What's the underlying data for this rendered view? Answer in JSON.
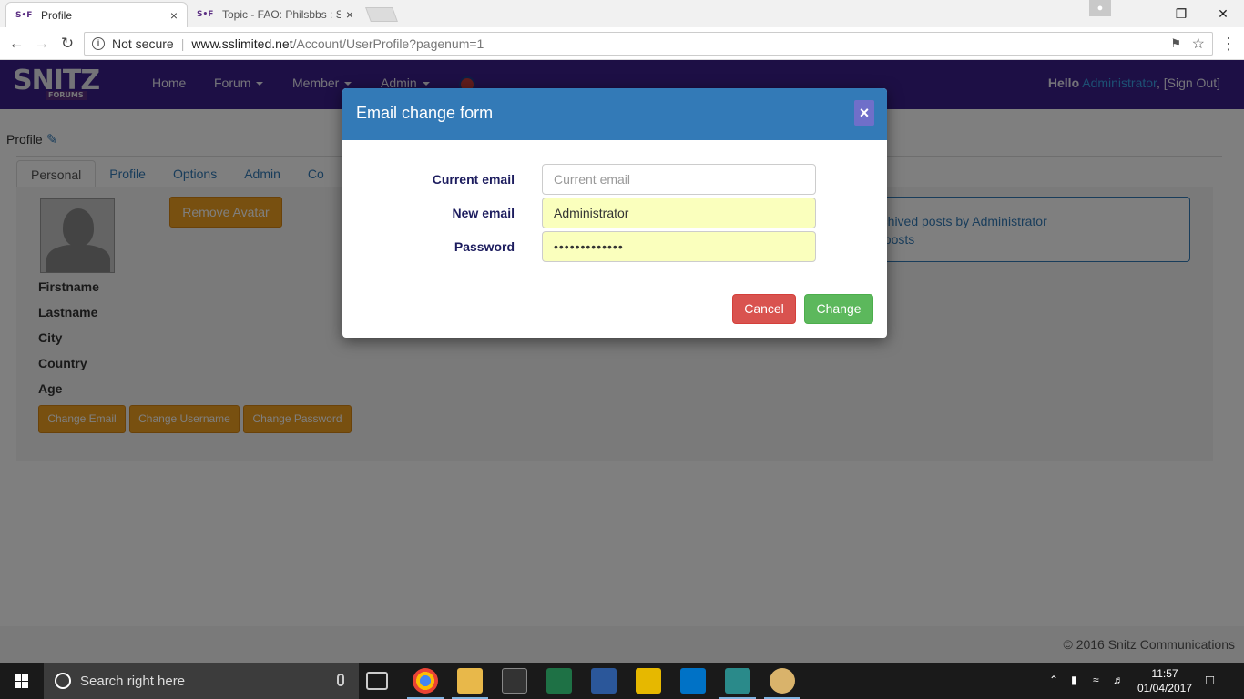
{
  "browser": {
    "tabs": [
      {
        "favicon": "S•F",
        "title": "Profile",
        "close": "×"
      },
      {
        "favicon": "S•F",
        "title": "Topic - FAO: Philsbbs : Sn",
        "close": "×"
      }
    ],
    "window_controls": {
      "minimize": "—",
      "maximize": "❐",
      "close": "✕"
    },
    "nav": {
      "back": "←",
      "forward": "→",
      "reload": "↻",
      "menu": "⋮"
    },
    "security": "Not secure",
    "url_host": "www.sslimited.net",
    "url_path": "/Account/UserProfile?pagenum=1"
  },
  "site": {
    "logo": "SNITZ",
    "logo_sub": "FORUMS",
    "nav": {
      "home": "Home",
      "forum": "Forum",
      "member": "Member",
      "admin": "Admin"
    },
    "hello_prefix": "Hello",
    "hello_user": "Administrator",
    "signout": ", [Sign Out]"
  },
  "profile": {
    "heading": "Profile",
    "tabs": [
      "Personal",
      "Profile",
      "Options",
      "Admin",
      "Co"
    ],
    "remove_avatar": "Remove Avatar",
    "fields": [
      "Firstname",
      "Lastname",
      "City",
      "Country",
      "Age"
    ],
    "buttons": {
      "change_email": "Change Email",
      "change_username": "Change Username",
      "change_password": "Change Password"
    },
    "stats": {
      "line1": "rchived posts by Administrator",
      "line2": "t posts"
    }
  },
  "footer": {
    "copyright": "© 2016 Snitz Communications"
  },
  "modal": {
    "title": "Email change form",
    "close": "×",
    "current_email_label": "Current email",
    "current_email_placeholder": "Current email",
    "new_email_label": "New email",
    "new_email_value": "Administrator",
    "password_label": "Password",
    "password_value": "•••••••••••••",
    "cancel": "Cancel",
    "change": "Change"
  },
  "taskbar": {
    "search_placeholder": "Search right here",
    "time": "11:57",
    "date": "01/04/2017"
  }
}
